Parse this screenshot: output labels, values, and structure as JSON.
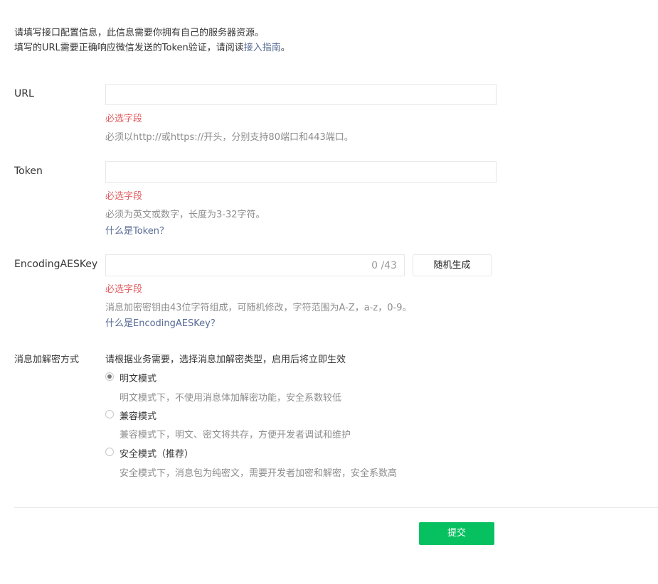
{
  "intro": {
    "line1": "请填写接口配置信息，此信息需要你拥有自己的服务器资源。",
    "line2_prefix": "填写的URL需要正确响应微信发送的Token验证，请阅读",
    "line2_link": "接入指南",
    "line2_suffix": "。"
  },
  "fields": {
    "url": {
      "label": "URL",
      "value": "",
      "error": "必选字段",
      "tip": "必须以http://或https://开头，分别支持80端口和443端口。"
    },
    "token": {
      "label": "Token",
      "value": "",
      "error": "必选字段",
      "tip": "必须为英文或数字，长度为3-32字符。",
      "help_link": "什么是Token？"
    },
    "aeskey": {
      "label": "EncodingAESKey",
      "value": "",
      "counter": "0 /43",
      "random_button": "随机生成",
      "error": "必选字段",
      "tip": "消息加密密钥由43位字符组成，可随机修改，字符范围为A-Z，a-z，0-9。",
      "help_link": "什么是EncodingAESKey？"
    }
  },
  "encryption": {
    "label": "消息加解密方式",
    "description": "请根据业务需要，选择消息加解密类型，启用后将立即生效",
    "selected": "plain",
    "options": [
      {
        "id": "plain",
        "label": "明文模式",
        "tip": "明文模式下，不使用消息体加解密功能，安全系数较低"
      },
      {
        "id": "compat",
        "label": "兼容模式",
        "tip": "兼容模式下，明文、密文将共存，方便开发者调试和维护"
      },
      {
        "id": "safe",
        "label": "安全模式（推荐）",
        "tip": "安全模式下，消息包为纯密文，需要开发者加密和解密，安全系数高"
      }
    ]
  },
  "submit_button": "提交",
  "colors": {
    "error": "#e15f63",
    "link": "#576b95",
    "submit": "#07c160"
  }
}
